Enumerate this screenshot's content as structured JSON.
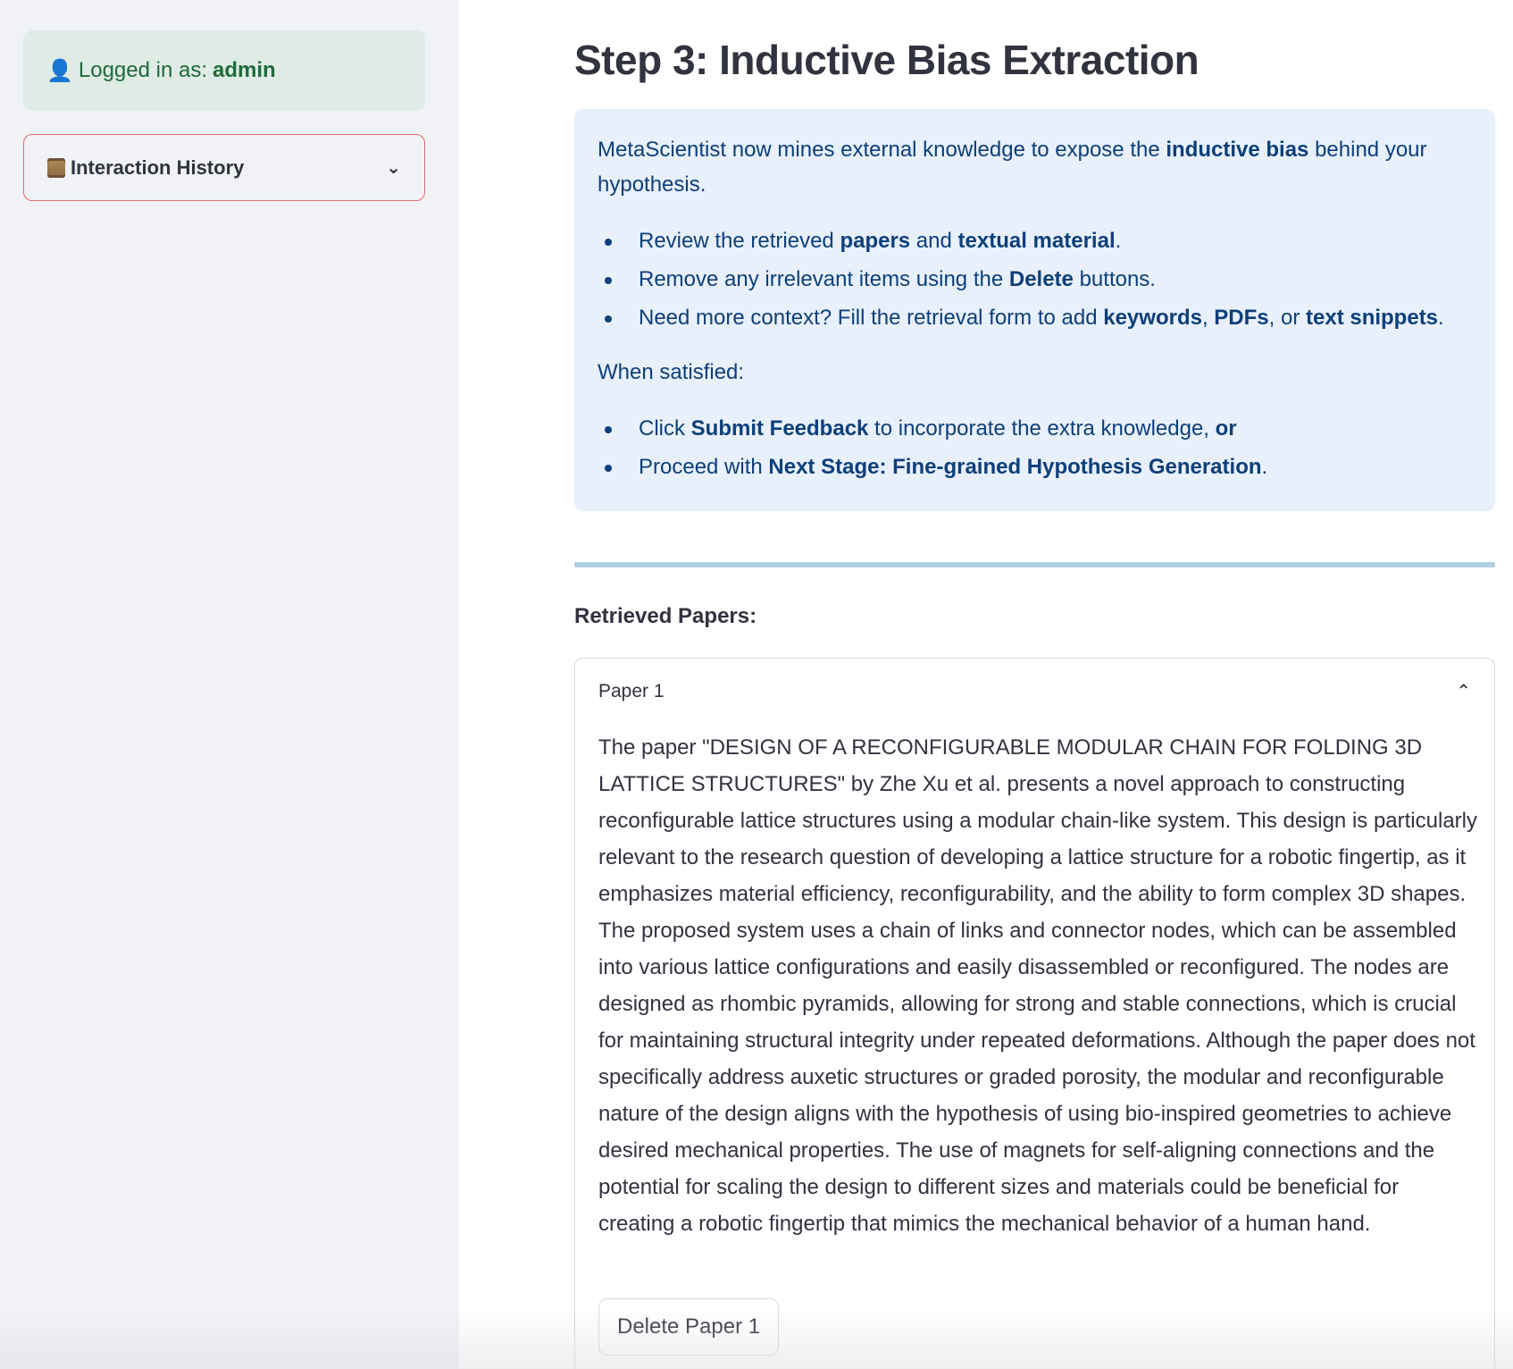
{
  "sidebar": {
    "login_label": "Logged in as:",
    "username": "admin",
    "history_label": "Interaction History"
  },
  "main": {
    "title": "Step 3: Inductive Bias Extraction",
    "info": {
      "intro_a": "MetaScientist now mines external knowledge to expose the ",
      "intro_b": "inductive bias",
      "intro_c": " behind your hypothesis.",
      "b1_a": "Review the retrieved ",
      "b1_b": "papers",
      "b1_c": " and ",
      "b1_d": "textual material",
      "b1_e": ".",
      "b2_a": "Remove any irrelevant items using the ",
      "b2_b": "Delete",
      "b2_c": " buttons.",
      "b3_a": "Need more context? Fill the retrieval form to add ",
      "b3_b": "keywords",
      "b3_c": ", ",
      "b3_d": "PDFs",
      "b3_e": ", or ",
      "b3_f": "text snippets",
      "b3_g": ".",
      "when": "When satisfied:",
      "b4_a": "Click ",
      "b4_b": "Submit Feedback",
      "b4_c": " to incorporate the extra knowledge, ",
      "b4_d": "or",
      "b5_a": "Proceed with ",
      "b5_b": "Next Stage: Fine-grained Hypothesis Generation",
      "b5_c": "."
    },
    "retrieved_label": "Retrieved Papers:",
    "papers": [
      {
        "title": "Paper 1",
        "summary": "The paper \"DESIGN OF A RECONFIGURABLE MODULAR CHAIN FOR FOLDING 3D LATTICE STRUCTURES\" by Zhe Xu et al. presents a novel approach to constructing reconfigurable lattice structures using a modular chain-like system. This design is particularly relevant to the research question of developing a lattice structure for a robotic fingertip, as it emphasizes material efficiency, reconfigurability, and the ability to form complex 3D shapes. The proposed system uses a chain of links and connector nodes, which can be assembled into various lattice configurations and easily disassembled or reconfigured. The nodes are designed as rhombic pyramids, allowing for strong and stable connections, which is crucial for maintaining structural integrity under repeated deformations. Although the paper does not specifically address auxetic structures or graded porosity, the modular and reconfigurable nature of the design aligns with the hypothesis of using bio-inspired geometries to achieve desired mechanical properties. The use of magnets for self-aligning connections and the potential for scaling the design to different sizes and materials could be beneficial for creating a robotic fingertip that mimics the mechanical behavior of a human hand.",
        "delete_label": "Delete Paper 1"
      }
    ]
  }
}
